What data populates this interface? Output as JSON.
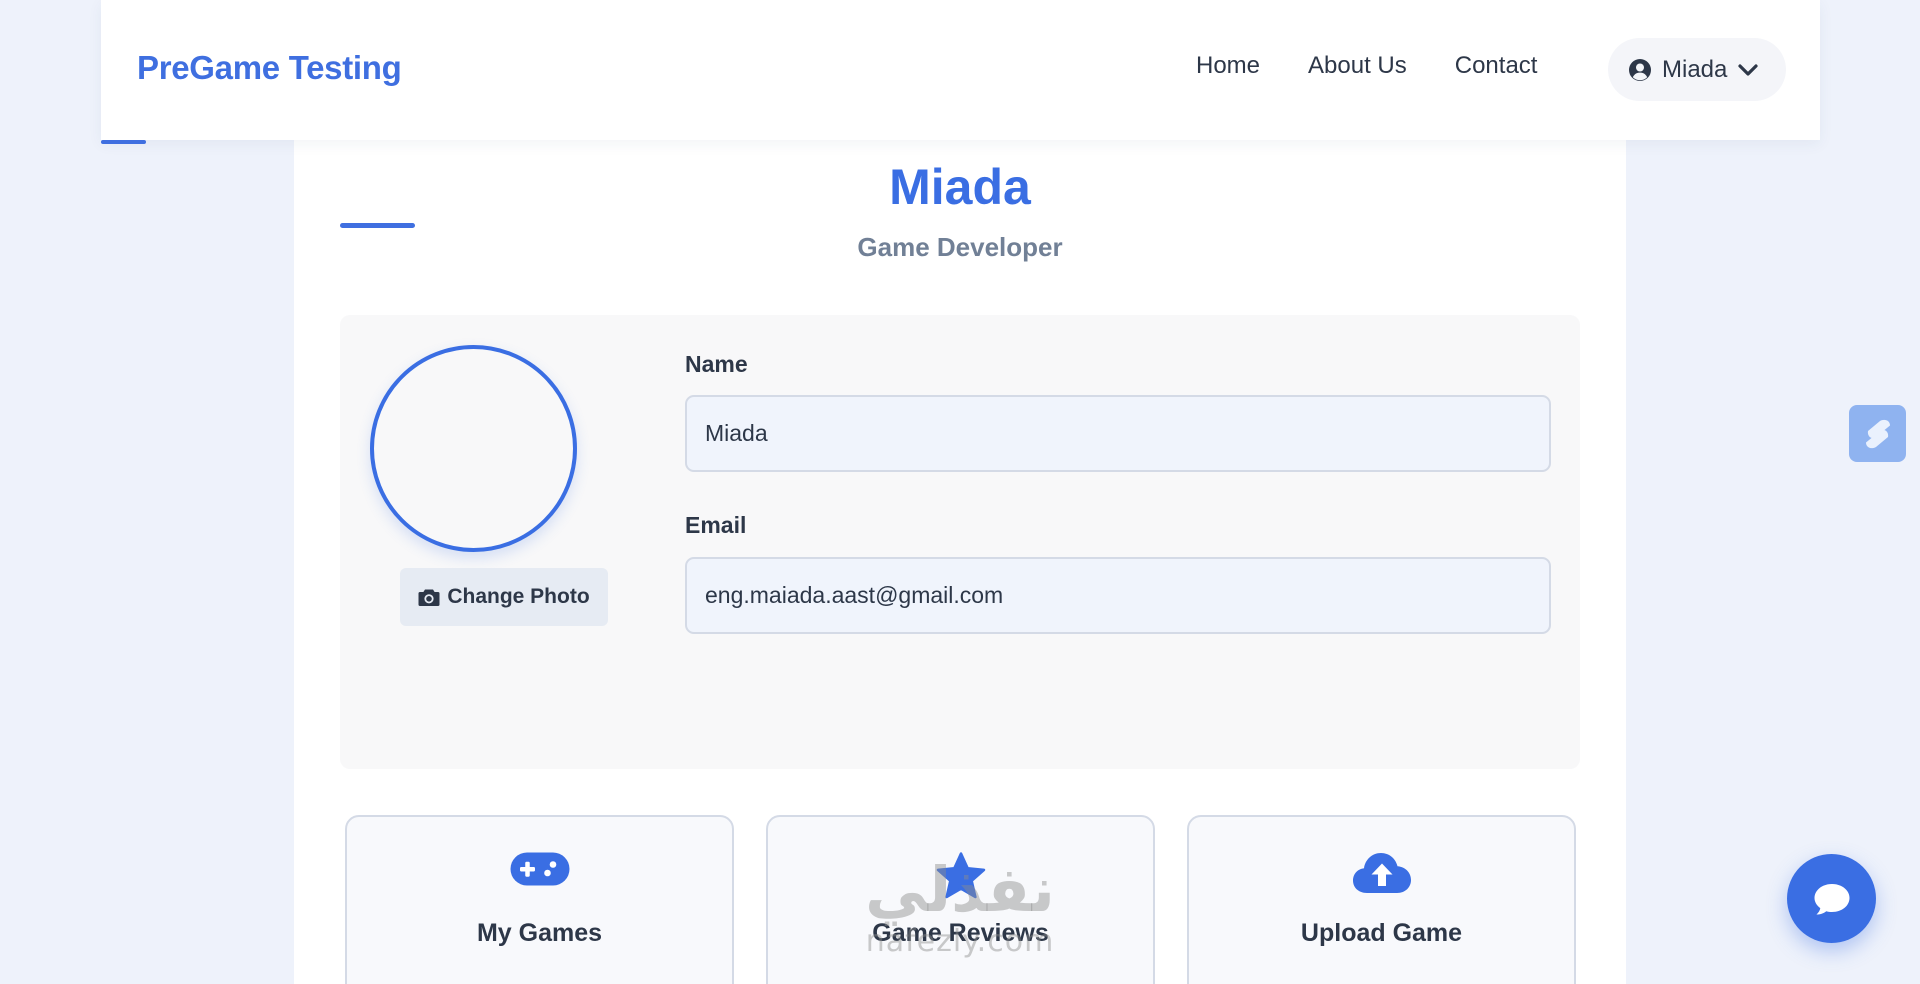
{
  "header": {
    "brand": "PreGame Testing",
    "nav": [
      "Home",
      "About Us",
      "Contact"
    ],
    "user_name": "Miada",
    "user_icon": "user-circle-icon",
    "dropdown_icon": "chevron-down-icon"
  },
  "profile": {
    "name": "Miada",
    "role": "Game Developer",
    "change_photo_label": "Change Photo",
    "change_photo_icon": "camera-icon",
    "fields": {
      "name_label": "Name",
      "name_value": "Miada",
      "email_label": "Email",
      "email_value": "eng.maiada.aast@gmail.com"
    }
  },
  "actions": [
    {
      "label": "My Games",
      "icon": "gamepad-icon"
    },
    {
      "label": "Game Reviews",
      "icon": "star-icon"
    },
    {
      "label": "Upload Game",
      "icon": "cloud-upload-icon"
    }
  ],
  "floating": {
    "chat_icon": "chat-bubble-icon",
    "side_widget_icon": "widget-icon"
  },
  "watermark": {
    "arabic": "نفذلي",
    "latin": "nafezly.com"
  },
  "colors": {
    "accent": "#3a6ee3",
    "page_background": "#eef2fb",
    "text": "#2d3748",
    "muted": "#718096"
  }
}
